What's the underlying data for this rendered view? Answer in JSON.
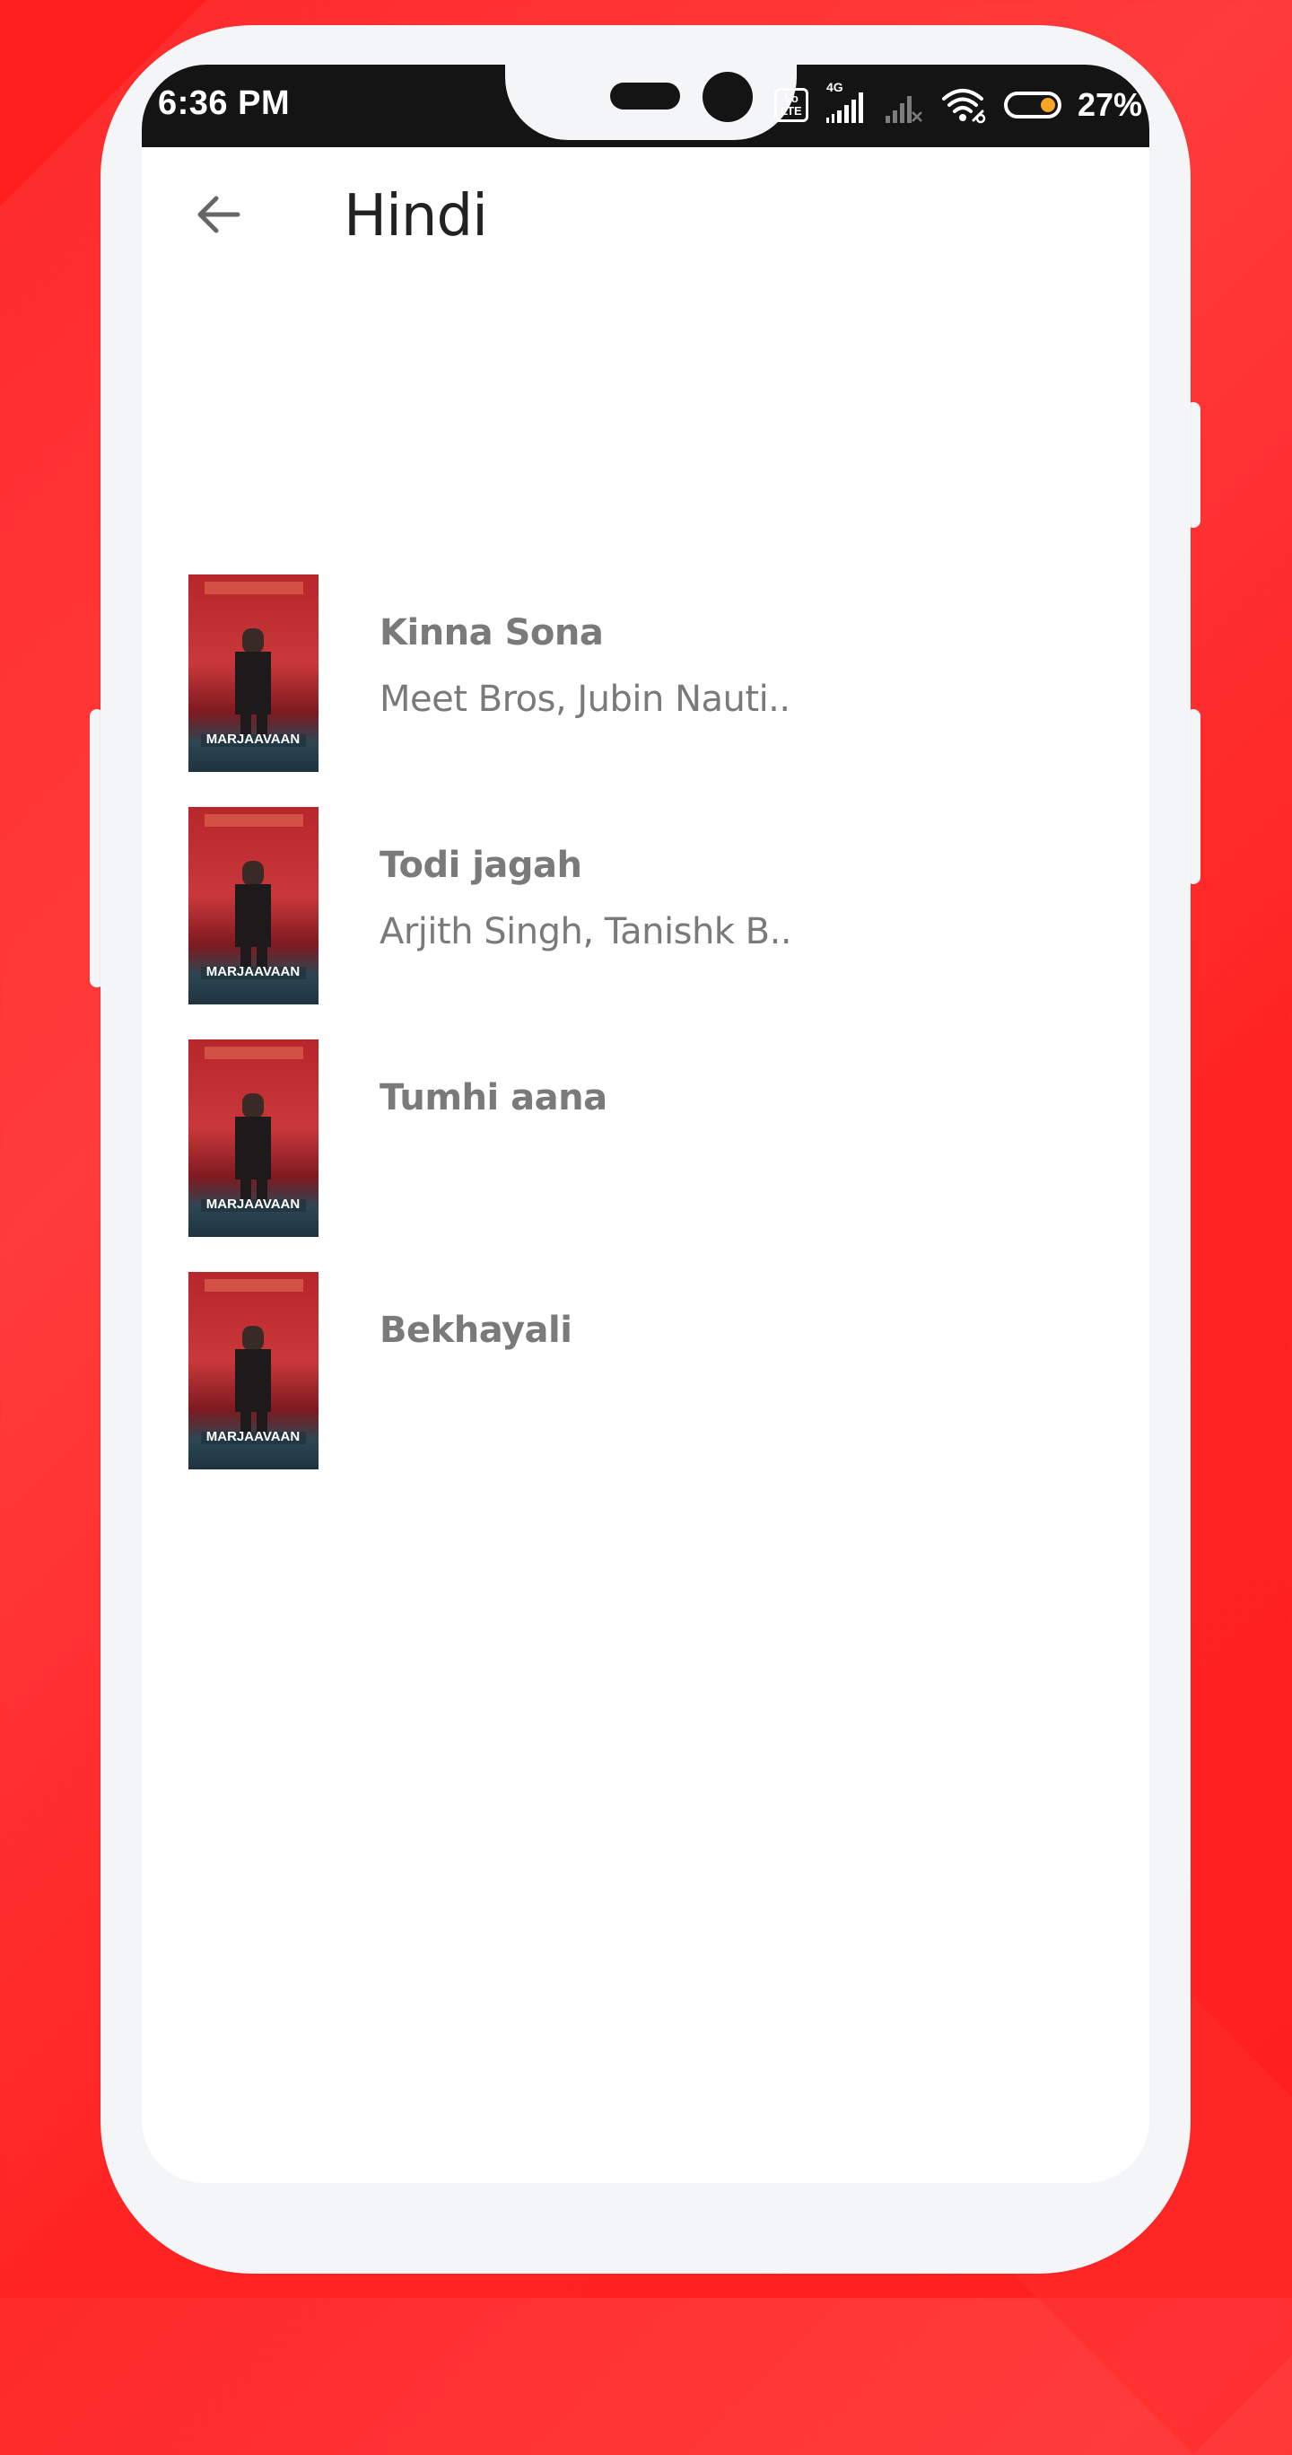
{
  "status_bar": {
    "time": "6:36 PM",
    "volte_label": "Vo LTE",
    "network_type": "4G",
    "battery_percent": "27%",
    "battery_level": 0.27,
    "icons": [
      "volte-icon",
      "signal-icon",
      "signal-no-service-icon",
      "wifi-icon",
      "battery-icon"
    ]
  },
  "header": {
    "back_icon": "arrow-left-icon",
    "title": "Hindi"
  },
  "songs": [
    {
      "title": "Kinna Sona",
      "artists": "Meet Bros, Jubin Nauti..",
      "poster_text": "MARJAAVAAN"
    },
    {
      "title": "Todi jagah",
      "artists": "Arjith Singh, Tanishk B..",
      "poster_text": "MARJAAVAAN"
    },
    {
      "title": "Tumhi aana",
      "artists": "",
      "poster_text": "MARJAAVAAN"
    },
    {
      "title": "Bekhayali",
      "artists": "",
      "poster_text": "MARJAAVAAN"
    }
  ],
  "colors": {
    "background_red": "#ff2a2a",
    "phone_frame": "#f4f5f7",
    "status_bar": "#141414",
    "title_text": "#222222",
    "song_text": "#7a7a7a",
    "battery_fill": "#f5a623"
  }
}
